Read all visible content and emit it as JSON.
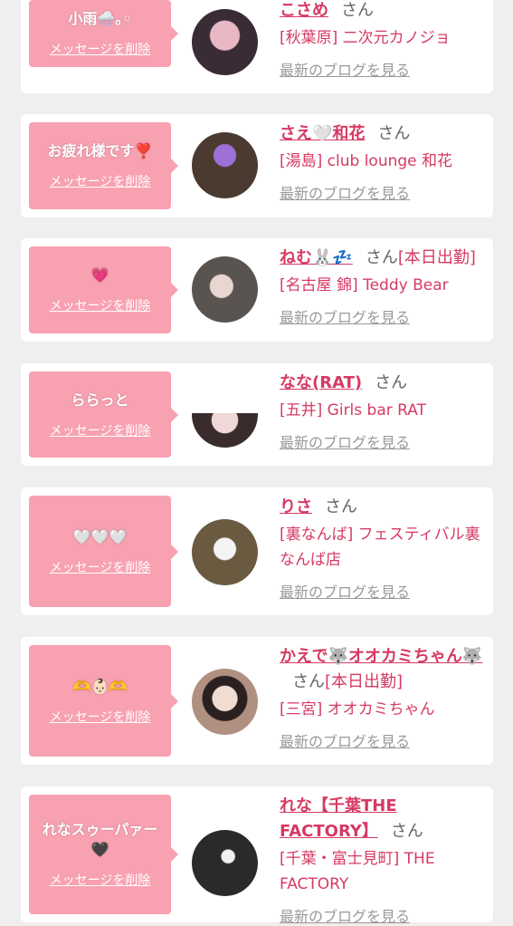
{
  "cards": [
    {
      "message": "小雨🌨️｡◦",
      "delete_label": "メッセージを削除",
      "name": "こさめ",
      "honorific": "さん",
      "status": "",
      "shop": "[秋葉原] 二次元カノジョ",
      "blog_label": "最新のブログを見る",
      "avatar_color": "#3a2c34"
    },
    {
      "message": "お疲れ様です❣️",
      "delete_label": "メッセージを削除",
      "name": "さえ🤍和花",
      "honorific": "さん",
      "status": "",
      "shop": "[湯島] club lounge 和花",
      "blog_label": "最新のブログを見る",
      "avatar_color": "#4a3a30"
    },
    {
      "message": "💗",
      "delete_label": "メッセージを削除",
      "name": "ねむ🐰💤",
      "honorific": "さん",
      "status": "[本日出勤]",
      "shop": "[名古屋 錦] Teddy Bear",
      "blog_label": "最新のブログを見る",
      "avatar_color": "#5a5450"
    },
    {
      "message": "ららっと",
      "delete_label": "メッセージを削除",
      "name": "なな(RAT)",
      "honorific": "さん",
      "status": "",
      "shop": "[五井] Girls bar RAT",
      "blog_label": "最新のブログを見る",
      "avatar_color": "#e8d0d2"
    },
    {
      "message": "🤍🤍🤍",
      "delete_label": "メッセージを削除",
      "name": "りさ",
      "honorific": "さん",
      "status": "",
      "shop": "[裏なんば] フェスティバル裏なんば店",
      "blog_label": "最新のブログを見る",
      "avatar_color": "#6a5a40"
    },
    {
      "message": "🫶👶🏻🫶",
      "delete_label": "メッセージを削除",
      "name": "かえで🐺オオカミちゃん🐺",
      "honorific": "さん",
      "status": "[本日出勤]",
      "shop": "[三宮] オオカミちゃん",
      "blog_label": "最新のブログを見る",
      "avatar_color": "#b09080"
    },
    {
      "message": "れなスゥーパァー🖤",
      "delete_label": "メッセージを削除",
      "name": "れな【千葉THE FACTORY】",
      "honorific": "さん",
      "status": "",
      "shop": "[千葉・富士見町] THE FACTORY",
      "blog_label": "最新のブログを見る",
      "avatar_color": "#2a2a2a"
    }
  ]
}
